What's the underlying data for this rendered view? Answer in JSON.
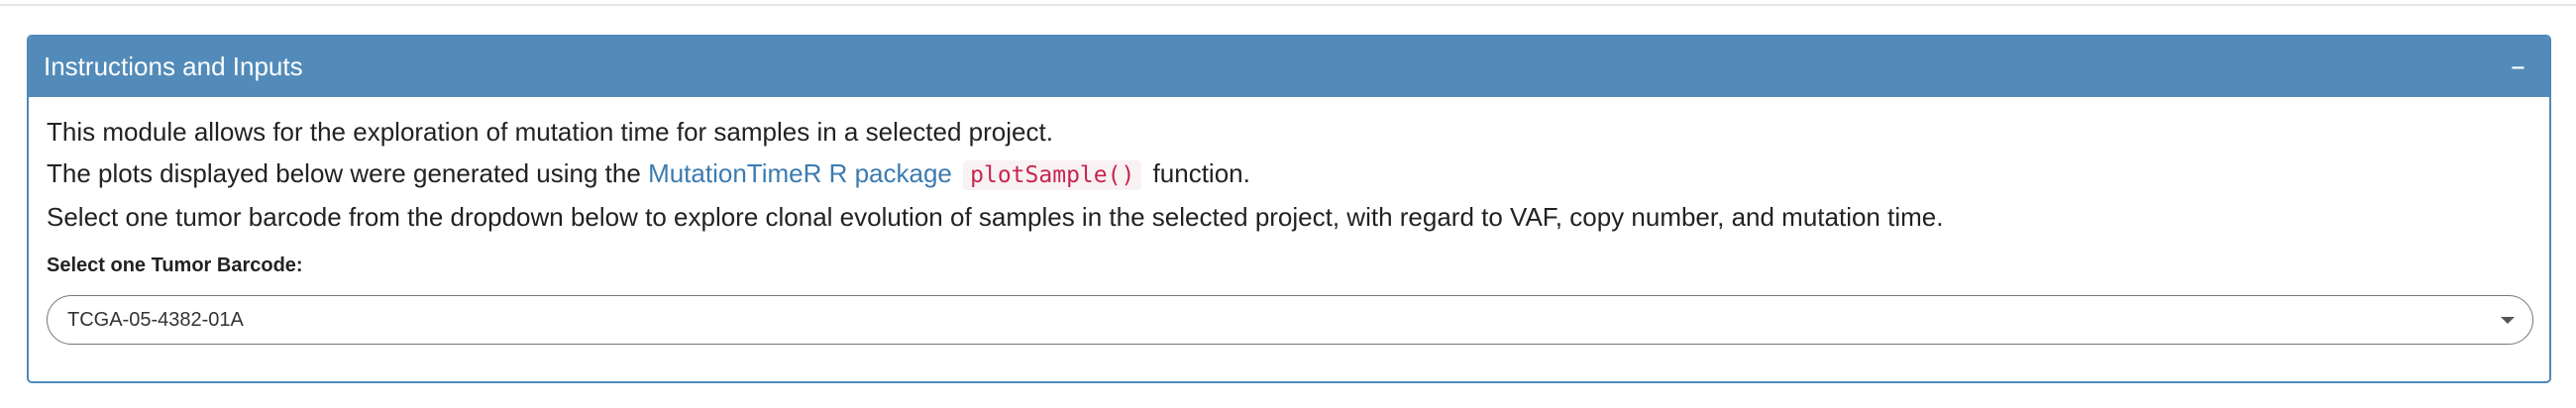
{
  "panel": {
    "title": "Instructions and Inputs",
    "collapse_symbol": "–"
  },
  "body": {
    "line1": "This module allows for the exploration of mutation time for samples in a selected project.",
    "line2_prefix": "The plots displayed below were generated using the",
    "line2_link": "MutationTimeR R package",
    "line2_code": "plotSample()",
    "line2_suffix": "function.",
    "line3": "Select one tumor barcode from the dropdown below to explore clonal evolution of samples in the selected project, with regard to VAF, copy number, and mutation time."
  },
  "input": {
    "label": "Select one Tumor Barcode:",
    "selected_value": "TCGA-05-4382-01A"
  },
  "icons": {
    "collapse": "minus-icon",
    "dropdown": "caret-down-icon"
  },
  "colors": {
    "header_bg": "#528bb9",
    "link": "#3c7bb0",
    "code_text": "#c7254e",
    "code_bg": "#f9f2f4"
  }
}
